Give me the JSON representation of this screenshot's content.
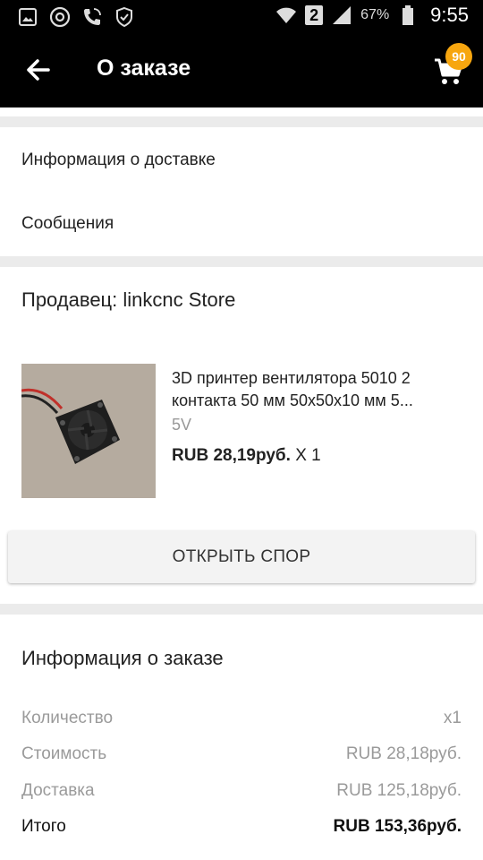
{
  "status": {
    "battery": "67%",
    "time": "9:55",
    "sim": "2"
  },
  "appbar": {
    "title": "О заказе",
    "cart_count": "90"
  },
  "links": {
    "delivery": "Информация о доставке",
    "messages": "Сообщения"
  },
  "seller": {
    "label": "Продавец: linkcnc Store"
  },
  "product": {
    "name": "3D принтер вентилятора 5010 2 контакта 50 мм 50x50x10 мм 5...",
    "variant": "5V",
    "price": "RUB 28,19руб.",
    "qty": " X 1"
  },
  "dispute_label": "ОТКРЫТЬ СПОР",
  "order_info": {
    "title": "Информация о заказе",
    "rows": [
      {
        "label": "Количество",
        "value": "x1"
      },
      {
        "label": "Стоимость",
        "value": "RUB 28,18руб."
      },
      {
        "label": "Доставка",
        "value": "RUB 125,18руб."
      },
      {
        "label": "Итого",
        "value": "RUB 153,36руб."
      }
    ]
  },
  "colors": {
    "badge": "#f7a60f",
    "appbar": "#000000"
  }
}
